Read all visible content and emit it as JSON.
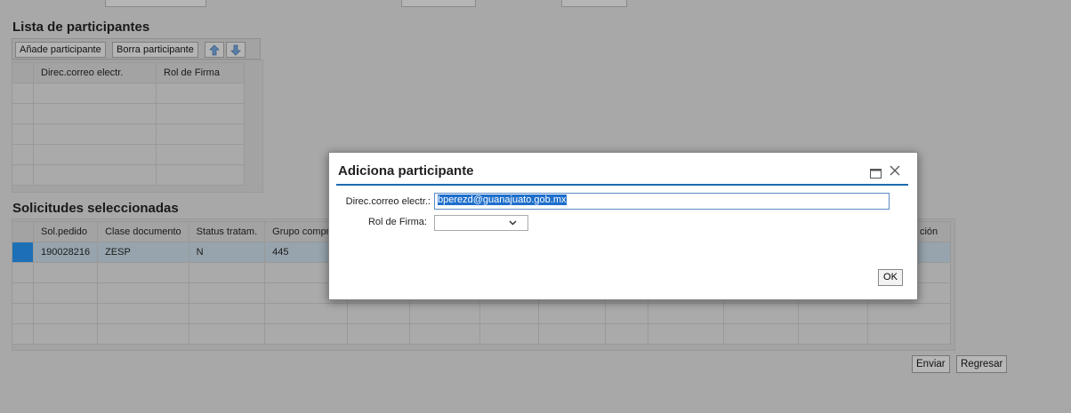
{
  "participants": {
    "title": "Lista de participantes",
    "add_button": "Añade participante",
    "delete_button": "Borra participante",
    "up_icon": "arrow-up-icon",
    "down_icon": "arrow-down-icon",
    "columns": [
      "Direc.correo electr.",
      "Rol de Firma"
    ]
  },
  "requests": {
    "title": "Solicitudes seleccionadas",
    "columns": [
      "Sol.pedido",
      "Clase documento",
      "Status tratam.",
      "Grupo compras",
      "",
      "",
      "",
      "",
      "",
      "",
      "",
      "",
      "ción"
    ],
    "row": [
      "190028216",
      "ZESP",
      "N",
      "445"
    ]
  },
  "actions": {
    "send": "Enviar",
    "back": "Regresar"
  },
  "dialog": {
    "title": "Adiciona participante",
    "email_label": "Direc.correo electr.:",
    "email_value": "bperezd@guanajuato.gob.mx",
    "role_label": "Rol de Firma:",
    "role_value": "",
    "ok": "OK",
    "maximize_icon": "maximize-icon",
    "close_icon": "close-icon",
    "accent": "#1c6bb0"
  }
}
